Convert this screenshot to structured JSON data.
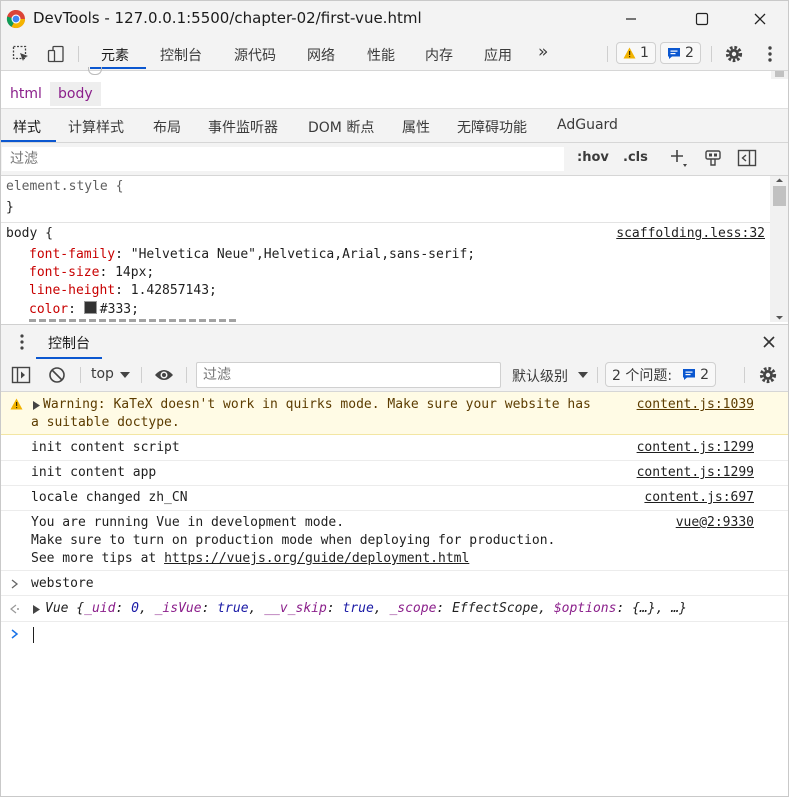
{
  "window": {
    "title": "DevTools - 127.0.0.1:5500/chapter-02/first-vue.html"
  },
  "toolbar": {
    "tabs": [
      {
        "label": "元素"
      },
      {
        "label": "控制台"
      },
      {
        "label": "源代码"
      },
      {
        "label": "网络"
      },
      {
        "label": "性能"
      },
      {
        "label": "内存"
      },
      {
        "label": "应用"
      }
    ],
    "more": "»",
    "warnings_count": "1",
    "messages_count": "2"
  },
  "breadcrumb": [
    {
      "label": "html"
    },
    {
      "label": "body"
    }
  ],
  "styles_tabs": [
    {
      "label": "样式"
    },
    {
      "label": "计算样式"
    },
    {
      "label": "布局"
    },
    {
      "label": "事件监听器"
    },
    {
      "label": "DOM 断点"
    },
    {
      "label": "属性"
    },
    {
      "label": "无障碍功能"
    },
    {
      "label": "AdGuard"
    }
  ],
  "styles_filter": {
    "placeholder": "过滤",
    "hov": ":hov",
    "cls": ".cls"
  },
  "styles_pane": {
    "element_style_open": "element.style {",
    "element_style_close": "}",
    "body_selector": "body {",
    "body_source": "scaffolding.less:32",
    "declarations": [
      {
        "prop": "font-family",
        "value": "\"Helvetica Neue\",Helvetica,Arial,sans-serif;"
      },
      {
        "prop": "font-size",
        "value": "14px;"
      },
      {
        "prop": "line-height",
        "value": "1.42857143;"
      },
      {
        "prop": "color",
        "value": "#333;",
        "swatch": "#333333"
      }
    ]
  },
  "drawer": {
    "tab_label": "控制台"
  },
  "console_toolbar": {
    "context": "top",
    "filter_placeholder": "过滤",
    "level": "默认级别",
    "issues_label": "2 个问题:",
    "issues_count": "2"
  },
  "console_messages": [
    {
      "type": "warning",
      "line1": "Warning: KaTeX doesn't work in quirks mode. Make sure your website has",
      "line2": "a suitable doctype.",
      "source": "content.js:1039"
    },
    {
      "type": "log",
      "text": "init content script",
      "source": "content.js:1299"
    },
    {
      "type": "log",
      "text": "init content app",
      "source": "content.js:1299"
    },
    {
      "type": "log",
      "text": "locale changed zh_CN",
      "source": "content.js:697"
    },
    {
      "type": "log",
      "line1": "You are running Vue in development mode.",
      "line2": "Make sure to turn on production mode when deploying for production.",
      "line3_prefix": "See more tips at ",
      "line3_link": "https://vuejs.org/guide/deployment.html",
      "source": "vue@2:9330"
    },
    {
      "type": "input",
      "text": "webstore"
    },
    {
      "type": "result",
      "name": "Vue",
      "body_open": " {",
      "k1": "_uid",
      "v1": "0",
      "k2": "_isVue",
      "v2": "true",
      "k3": "__v_skip",
      "v3": "true",
      "k4": "_scope",
      "v4": "EffectScope",
      "k5": "$options",
      "v5": "{…}",
      "tail": ", …}"
    }
  ],
  "colors": {
    "accent": "#0b57d0",
    "warning_bg": "#fffbe5",
    "css_property": "#c80000"
  }
}
